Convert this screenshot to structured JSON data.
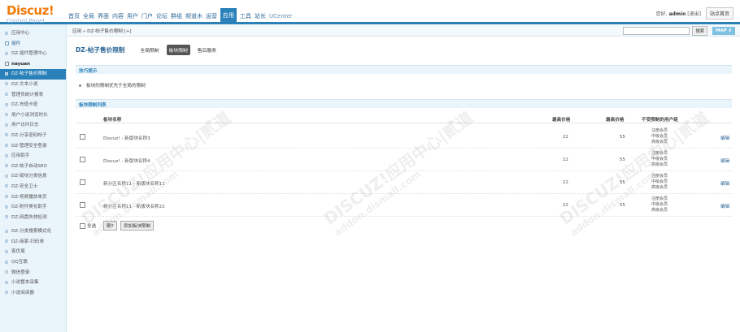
{
  "header": {
    "logo": "Discuz!",
    "logo_sub": "Control Panel",
    "nav": [
      "首页",
      "全局",
      "界面",
      "内容",
      "用户",
      "门户",
      "论坛",
      "群组",
      "频道木",
      "运营",
      "应用",
      "工具",
      "站长",
      "UCenter"
    ],
    "active_nav": "应用",
    "greeting_prefix": "您好,",
    "user": "admin",
    "logout": "[退出]",
    "home_button": "站点首页"
  },
  "sidebar": {
    "items": [
      {
        "label": "应用中心",
        "kind": "item"
      },
      {
        "label": "插件",
        "kind": "group"
      },
      {
        "label": "DZ-插件管理中心",
        "kind": "item"
      },
      {
        "label": "nayuan",
        "kind": "head"
      },
      {
        "label": "DZ-帖子售价限制",
        "kind": "active"
      },
      {
        "label": "DZ-文本小说",
        "kind": "item"
      },
      {
        "label": "管理员统计报表",
        "kind": "item"
      },
      {
        "label": "DZ-充值卡密",
        "kind": "item"
      },
      {
        "label": "用户小说浏览时长",
        "kind": "item"
      },
      {
        "label": "用户访问日志",
        "kind": "item"
      },
      {
        "label": "DZ-分享密码帖子",
        "kind": "item"
      },
      {
        "label": "DZ-管理安全登录",
        "kind": "item"
      },
      {
        "label": "应用助手",
        "kind": "item"
      },
      {
        "label": "DZ-帖子自动SEO",
        "kind": "item"
      },
      {
        "label": "DZ-版块分类信息",
        "kind": "item"
      },
      {
        "label": "DZ-安全卫士",
        "kind": "item"
      },
      {
        "label": "DZ-视频播放单页",
        "kind": "item"
      },
      {
        "label": "DZ-附件美化助手",
        "kind": "item"
      },
      {
        "label": "DZ-网盘失效检测",
        "kind": "item"
      },
      {
        "label": "DZ-分类搜索模式化",
        "kind": "item"
      },
      {
        "label": "DZ-商家-扫码单",
        "kind": "item"
      },
      {
        "label": "客优易",
        "kind": "item"
      },
      {
        "label": "QQ互联",
        "kind": "item"
      },
      {
        "label": "微信登录",
        "kind": "item"
      },
      {
        "label": "小说整本采集",
        "kind": "item"
      },
      {
        "label": "小说阅读器",
        "kind": "item"
      }
    ]
  },
  "breadcrumb": "应用 » DZ-帖子售价限制 [+]",
  "search": {
    "value": "",
    "button": "搜索",
    "map": "MAP ⬇"
  },
  "page_title": "DZ-帖子售价限制",
  "tabs": [
    "全局限制",
    "板块限制",
    "售后服务"
  ],
  "active_tab": "板块限制",
  "tips": {
    "title": "技巧提示",
    "text": "板块的限制优先于全局的限制"
  },
  "list": {
    "title": "板块限制列表",
    "headers": {
      "name": "板块名称",
      "max": "最高价格",
      "min": "最高价格",
      "groups": "不受限制的用户组"
    },
    "rows": [
      {
        "name": "Discuz! - 新版块名称3",
        "max": "22",
        "min": "55",
        "groups": [
          "注册会员",
          "中级会员",
          "高级会员"
        ],
        "action": "编辑"
      },
      {
        "name": "Discuz! - 新版块名称4",
        "max": "22",
        "min": "55",
        "groups": [
          "注册会员",
          "中级会员",
          "高级会员"
        ],
        "action": "编辑"
      },
      {
        "name": "新分区名称11 - 新版块名称11",
        "max": "22",
        "min": "55",
        "groups": [
          "注册会员",
          "中级会员",
          "高级会员"
        ],
        "action": "编辑"
      },
      {
        "name": "新分区名称11 - 新版块名称22",
        "max": "22",
        "min": "55",
        "groups": [
          "注册会员",
          "中级会员",
          "高级会员"
        ],
        "action": "编辑"
      }
    ],
    "select_all": "全选",
    "delete_button": "删?",
    "add_button": "添加板块限制"
  },
  "watermark": {
    "title": "DISCUZ!应用中心|贰道",
    "url": "addon.dismall.com"
  },
  "colors": {
    "accent": "#2a80b9",
    "logo_orange": "#f07b0a",
    "sidebar_bg": "#eaf4fb"
  }
}
